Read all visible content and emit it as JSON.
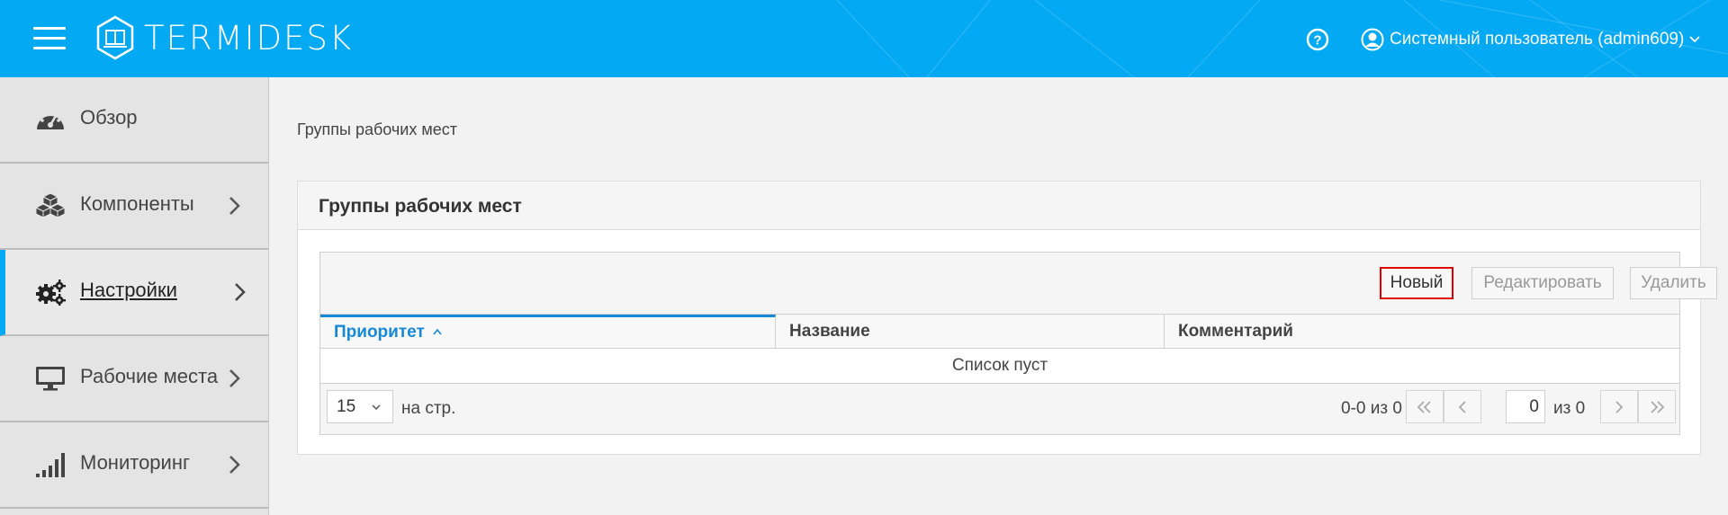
{
  "header": {
    "logo_text": "TERMIDESK",
    "user_name": "Системный пользователь (admin609)",
    "colors": {
      "header_bg": "#04a9f4",
      "accent": "#1589d8",
      "highlight_border": "#e00000"
    },
    "icons": [
      "menu-icon",
      "logo-icon",
      "help-icon",
      "user-icon",
      "chevron-down-icon"
    ]
  },
  "sidebar": {
    "items": [
      {
        "label": "Обзор",
        "icon": "dashboard-icon",
        "has_submenu": false
      },
      {
        "label": "Компоненты",
        "icon": "components-icon",
        "has_submenu": true
      },
      {
        "label": "Настройки",
        "icon": "settings-icon",
        "has_submenu": true,
        "active": true
      },
      {
        "label": "Рабочие места",
        "icon": "monitor-icon",
        "has_submenu": true
      },
      {
        "label": "Мониторинг",
        "icon": "signal-icon",
        "has_submenu": true
      }
    ]
  },
  "main": {
    "breadcrumb": "Группы рабочих мест",
    "panel_title": "Группы рабочих мест",
    "toolbar": {
      "new_label": "Новый",
      "edit_label": "Редактировать",
      "delete_label": "Удалить"
    },
    "table": {
      "columns": [
        {
          "label": "Приоритет",
          "sorted": "asc"
        },
        {
          "label": "Название"
        },
        {
          "label": "Комментарий"
        }
      ],
      "empty_text": "Список пуст"
    },
    "pager": {
      "per_page": "15",
      "per_page_label": "на стр.",
      "range": "0-0 из 0",
      "page": "0",
      "of_label": "из 0"
    }
  }
}
